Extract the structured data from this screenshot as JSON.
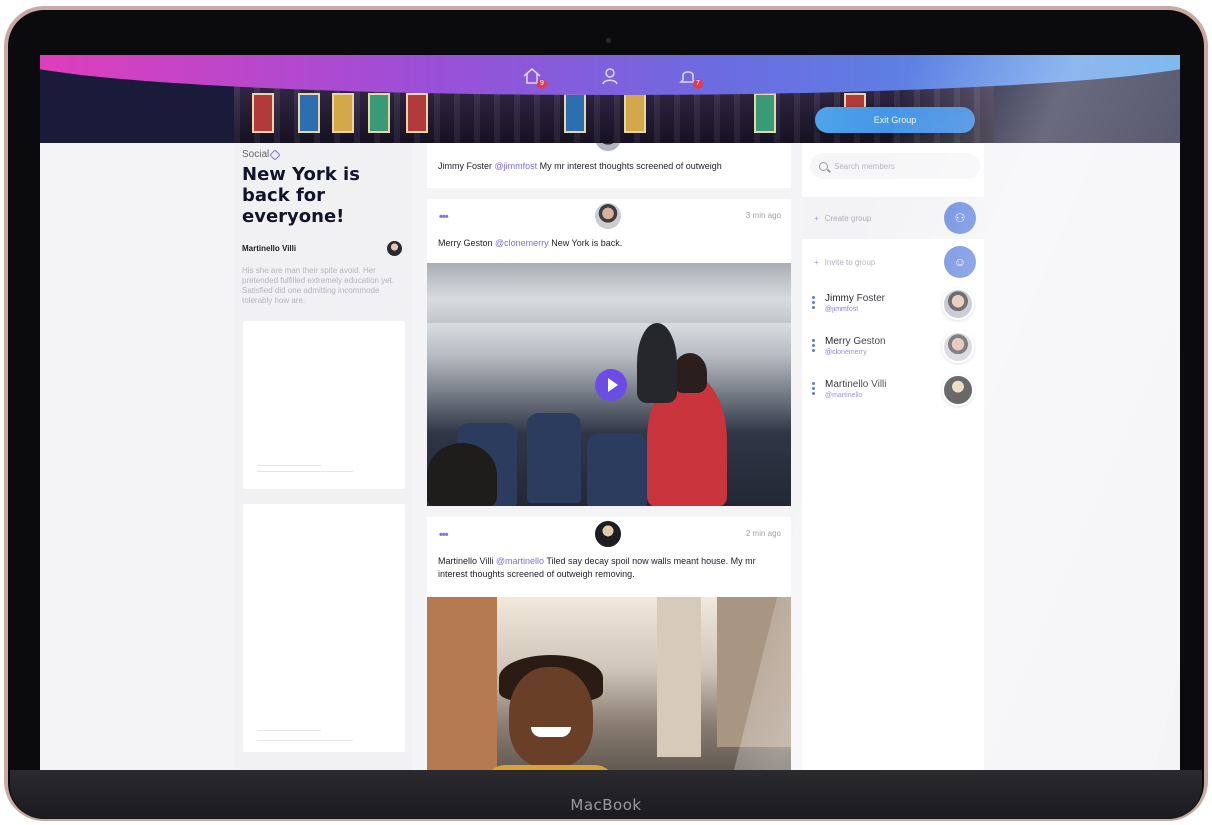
{
  "device": {
    "brand": "MacBook"
  },
  "header": {
    "nav": [
      {
        "icon": "home-icon",
        "badge": "9"
      },
      {
        "icon": "user-icon",
        "badge": ""
      },
      {
        "icon": "bell-icon",
        "badge": "7"
      }
    ],
    "exit_button": "Exit Group"
  },
  "left": {
    "logo": "Social",
    "headline": "New York is back for everyone!",
    "author": "Martinello Villi",
    "excerpt": "His she are man their spite avoid. Her pretended fulfilled extremely education yet. Satisfied did one admitting incommode tolerably how are."
  },
  "feed": {
    "posts": [
      {
        "author": "Jimmy Foster",
        "handle": "@jimmfost",
        "text": "My mr interest thoughts screened of outweigh",
        "time": ""
      },
      {
        "author": "Merry Geston",
        "handle": "@clonemerry",
        "text": "New York is back.",
        "time": "3 min ago"
      },
      {
        "author": "Martinello Villi",
        "handle": "@martinello",
        "text": "Tiled say decay spoil now walls meant house. My mr interest thoughts screened of outweigh removing.",
        "time": "2 min ago"
      }
    ]
  },
  "right": {
    "search_placeholder": "Search members",
    "actions": [
      {
        "label": "Create group",
        "icon": "group-icon"
      },
      {
        "label": "Invite to group",
        "icon": "user-icon"
      }
    ],
    "members": [
      {
        "name": "Jimmy Foster",
        "handle": "@jimmfost"
      },
      {
        "name": "Merry Geston",
        "handle": "@clonemerry"
      },
      {
        "name": "Martinello Villi",
        "handle": "@martinello"
      }
    ]
  },
  "colors": {
    "accent": "#5b7fde",
    "handle": "#7f6ee6",
    "gradient_start": "#e53cb8",
    "gradient_end": "#47a0e8"
  }
}
